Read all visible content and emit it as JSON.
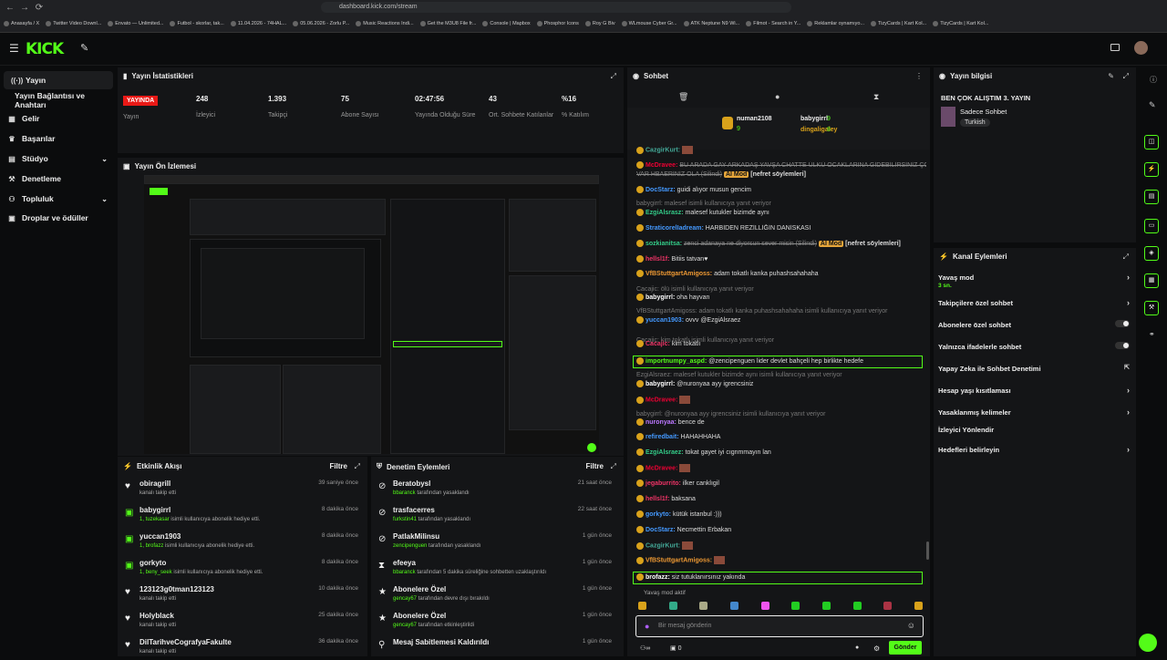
{
  "browser": {
    "url": "dashboard.kick.com/stream",
    "bookmarks": [
      "Anasayfa / X",
      "Twitter Video Downl...",
      "Envato — Unlimited...",
      "Futbol - skorlar, tak...",
      "11.04.2026 - 74HAL...",
      "05.06.2026 - Zorlu P...",
      "Music Reactions Indi...",
      "Get the M3U8 File fr...",
      "Console | Mapbox",
      "Phosphor Icons",
      "Roy G Biv",
      "WLmouse Cyber Gr...",
      "ATK Neptune N9 Wi...",
      "Filmot - Search in Y...",
      "Reklamlar oynamıyo...",
      "TizyCards | Kart Kol...",
      "TizyCards | Kart Kol..."
    ]
  },
  "app": {
    "logo": "KICK",
    "accent": "#53fc18"
  },
  "sidebar": {
    "items": [
      {
        "label": "Yayın",
        "icon": "broadcast-icon"
      },
      {
        "label": "Yayın Bağlantısı ve Anahtarı",
        "icon": ""
      },
      {
        "label": "Gelir",
        "icon": "dollar-icon"
      },
      {
        "label": "Başarılar",
        "icon": "trophy-icon"
      },
      {
        "label": "Stüdyo",
        "icon": "studio-icon"
      },
      {
        "label": "Denetleme",
        "icon": "gavel-icon"
      },
      {
        "label": "Topluluk",
        "icon": "community-icon"
      },
      {
        "label": "Droplar ve ödüller",
        "icon": "gift-icon"
      }
    ]
  },
  "stats": {
    "title": "Yayın İstatistikleri",
    "live_badge": "YAYINDA",
    "live_label": "Yayın",
    "items": [
      {
        "v": "248",
        "l": "İzleyici"
      },
      {
        "v": "1.393",
        "l": "Takipçi"
      },
      {
        "v": "75",
        "l": "Abone Sayısı"
      },
      {
        "v": "02:47:56",
        "l": "Yayında Olduğu Süre"
      },
      {
        "v": "43",
        "l": "Ort. Sohbete Katılanlar"
      },
      {
        "v": "%16",
        "l": "% Katılım"
      }
    ]
  },
  "preview": {
    "title": "Yayın Ön İzlemesi"
  },
  "activity": {
    "title": "Etkinlik Akışı",
    "filter": "Filtre",
    "items": [
      {
        "u": "obiragrill",
        "d": "kanalı takip etti",
        "hl": "",
        "t": "39 saniye önce",
        "icon": "heart-icon"
      },
      {
        "u": "babygirrl",
        "d": " isimli kullanıcıya abonelik hediye etti.",
        "hl": "1, tuzekasar",
        "t": "8 dakika önce",
        "icon": "gift-icon"
      },
      {
        "u": "yuccan1903",
        "d": " isimli kullanıcıya abonelik hediye etti.",
        "hl": "1, brofazz",
        "t": "8 dakika önce",
        "icon": "gift-icon"
      },
      {
        "u": "gorkyto",
        "d": " isimli kullanıcıya abonelik hediye etti.",
        "hl": "1, beny_seek",
        "t": "8 dakika önce",
        "icon": "gift-icon"
      },
      {
        "u": "123123g0tman123123",
        "d": "kanalı takip etti",
        "hl": "",
        "t": "10 dakika önce",
        "icon": "heart-icon"
      },
      {
        "u": "Holyblack",
        "d": "kanalı takip etti",
        "hl": "",
        "t": "25 dakika önce",
        "icon": "heart-icon"
      },
      {
        "u": "DilTarihveCografyaFakulte",
        "d": "kanalı takip etti",
        "hl": "",
        "t": "36 dakika önce",
        "icon": "heart-icon"
      }
    ]
  },
  "moderation": {
    "title": "Denetim Eylemleri",
    "filter": "Filtre",
    "items": [
      {
        "u": "Beratobysl",
        "hl": "bbaranck",
        "d": " tarafından yasaklandı",
        "t": "21 saat önce",
        "icon": "ban-icon"
      },
      {
        "u": "trasfacerres",
        "hl": "furkstin41",
        "d": " tarafından yasaklandı",
        "t": "22 saat önce",
        "icon": "ban-icon"
      },
      {
        "u": "PatlakMilinsu",
        "hl": "zencipenguen",
        "d": " tarafından yasaklandı",
        "t": "1 gün önce",
        "icon": "ban-icon"
      },
      {
        "u": "efeeya",
        "hl": "bbaranck",
        "d": " tarafından 5 dakika süreliğine sohbetten uzaklaştırıldı",
        "t": "1 gün önce",
        "icon": "hourglass-icon"
      },
      {
        "u": "Abonelere Özel",
        "hl": "gencay67",
        "d": " tarafından devre dışı bırakıldı",
        "t": "1 gün önce",
        "icon": "star-icon"
      },
      {
        "u": "Abonelere Özel",
        "hl": "gencay67",
        "d": " tarafından etkinleştirildi",
        "t": "1 gün önce",
        "icon": "star-icon"
      },
      {
        "u": "Mesaj Sabitlemesi Kaldırıldı",
        "hl": "",
        "d": "",
        "t": "1 gün önce",
        "icon": "pin-icon"
      }
    ]
  },
  "chat": {
    "title": "Sohbet",
    "top_gifters": [
      {
        "name": "numan2108",
        "count": "9"
      },
      {
        "name": "babygirrl",
        "count": "9"
      },
      {
        "name": "dingaligaley",
        "count": "8"
      }
    ],
    "messages": [
      {
        "user": "CazgirKurt:",
        "text": "",
        "color": "#4a9"
      },
      {
        "user": "McDravee:",
        "text": "BU ARADA GAY ARKADAŞ YAVŞA CHATTE ÜLKÜ OCAKLARINA GİDEBİLİRSİNİZ ÇOK",
        "color": "#e03",
        "strike": true
      },
      {
        "user": "",
        "text": "VAR HBAERİNİZ OLA (Silindi)",
        "color": "#e03",
        "strike": true,
        "tag": "AI Mod",
        "after": "[nefret söylemleri]"
      },
      {
        "user": "DocStarz:",
        "text": "guidi alıyor musun gencim",
        "color": "#49f"
      },
      {
        "user": "",
        "text": "babygirrl: malesef isimli kullanıcıya yanıt veriyor",
        "sys": true
      },
      {
        "user": "EzgiAlsrasz:",
        "text": "malesef kutukler bizimde aynı",
        "color": "#3c8"
      },
      {
        "user": "StraticorelIadream:",
        "text": "HARBİDEN REZİLLİĞİN DANİSKASI",
        "color": "#49f"
      },
      {
        "user": "sozkianitsa:",
        "text": "zenci adanaya ne diyorsun sever misin (Silindi)",
        "color": "#3c8",
        "strike": true,
        "tag": "AI Mod",
        "after": "[nefret söylemleri]"
      },
      {
        "user": "hellsl1f:",
        "text": "Bitiis tatvan♥",
        "color": "#e36"
      },
      {
        "user": "VfBStuttgartAmigoss:",
        "text": "adam tokatlı kanka puhashsahahaha",
        "color": "#e93"
      },
      {
        "user": "",
        "text": "Cacajic: ölü isimli kullanıcıya yanıt veriyor",
        "sys": true
      },
      {
        "user": "babygirrl:",
        "text": "oha hayvan",
        "color": "#fff"
      },
      {
        "user": "",
        "text": "VfBStuttgartAmigoss: adam tokatlı kanka puhashsahahaha isimli kullanıcıya yanıt veriyor",
        "sys": true
      },
      {
        "user": "yuccan1903:",
        "text": "ovvv @EzgiAlsraez",
        "color": "#49f"
      },
      {
        "user": "",
        "text": "Cacajic: kim tokatlı isimli kullanıcıya yanıt veriyor",
        "sys": true
      },
      {
        "user": "Cacajic:",
        "text": "kim tokatlı",
        "color": "#e36"
      },
      {
        "user": "importnumpy_aspd:",
        "text": "@zencipenguen lider devlet bahçeli hep birlikte hedefe",
        "color": "#53fc18",
        "hl": true
      },
      {
        "user": "",
        "text": "EzgiAlsraez: malesef kutukler bizimde aynı isimli kullanıcıya yanıt veriyor",
        "sys": true
      },
      {
        "user": "babygirrl:",
        "text": "@nuronyaa ayy igrencsiniz",
        "color": "#fff"
      },
      {
        "user": "McDravee:",
        "text": "",
        "color": "#e03"
      },
      {
        "user": "",
        "text": "babygirrl: @nuronyaa ayy igrencsiniz isimli kullanıcıya yanıt veriyor",
        "sys": true
      },
      {
        "user": "nuronyaa:",
        "text": "bence de",
        "color": "#b7f"
      },
      {
        "user": "refiredbait:",
        "text": "HAHAHHAHA",
        "color": "#49f"
      },
      {
        "user": "EzgiAlsraez:",
        "text": "tokat gayet iyi cıgnmmayın lan",
        "color": "#3c8"
      },
      {
        "user": "McDravee:",
        "text": "",
        "color": "#e03"
      },
      {
        "user": "jegaburrito:",
        "text": "ilker canklıgil",
        "color": "#e36"
      },
      {
        "user": "hellsl1f:",
        "text": "baksana",
        "color": "#e36"
      },
      {
        "user": "gorkyto:",
        "text": "kütük istanbul :)))",
        "color": "#49f"
      },
      {
        "user": "DocStarz:",
        "text": "Necmettin Erbakan",
        "color": "#49f"
      },
      {
        "user": "CazgirKurt:",
        "text": "",
        "color": "#4a9"
      },
      {
        "user": "VfBStuttgartAmigoss:",
        "text": "",
        "color": "#e93"
      },
      {
        "user": "brofazz:",
        "text": "siz tutuklanırsınız yakında",
        "color": "#fff",
        "hl": true
      }
    ],
    "slow_mode": "Yavaş mod aktif",
    "placeholder": "Bir mesaj gönderin",
    "send": "Gönder",
    "count": "0",
    "viewer_icon": "∞"
  },
  "stream_info": {
    "title": "Yayın bilgisi",
    "stream_title": "BEN ÇOK ALIŞTIM 3. YAYIN",
    "category": "Sadece Sohbet",
    "tag": "Turkish"
  },
  "channel_actions": {
    "title": "Kanal Eylemleri",
    "slow_sub": "3 sn.",
    "items": [
      {
        "label": "Yavaş mod",
        "kind": "arrow"
      },
      {
        "label": "Takipçilere özel sohbet",
        "kind": "arrow"
      },
      {
        "label": "Abonelere özel sohbet",
        "kind": "toggle"
      },
      {
        "label": "Yalnızca ifadelerle sohbet",
        "kind": "toggle"
      },
      {
        "label": "Yapay Zeka ile Sohbet Denetimi",
        "kind": "ext"
      },
      {
        "label": "Hesap yaşı kısıtlaması",
        "kind": "arrow"
      },
      {
        "label": "Yasaklanmış kelimeler",
        "kind": "arrow"
      },
      {
        "label": "İzleyici Yönlendir",
        "kind": "none"
      },
      {
        "label": "Hedefleri belirleyin",
        "kind": "arrow"
      }
    ]
  }
}
